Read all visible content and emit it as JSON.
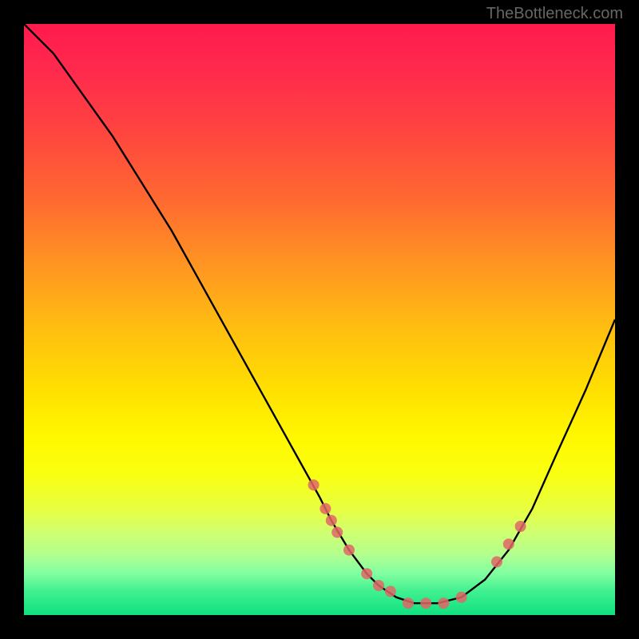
{
  "watermark": "TheBottleneck.com",
  "chart_data": {
    "type": "line",
    "title": "",
    "xlabel": "",
    "ylabel": "",
    "xlim": [
      0,
      100
    ],
    "ylim": [
      0,
      100
    ],
    "curve": {
      "x": [
        0,
        5,
        10,
        15,
        20,
        25,
        30,
        35,
        40,
        45,
        50,
        52,
        55,
        58,
        60,
        63,
        66,
        70,
        74,
        78,
        82,
        86,
        90,
        95,
        100
      ],
      "y": [
        100,
        95,
        88,
        81,
        73,
        65,
        56,
        47,
        38,
        29,
        20,
        16,
        11,
        7,
        5,
        3,
        2,
        2,
        3,
        6,
        11,
        18,
        27,
        38,
        50
      ]
    },
    "markers": {
      "x": [
        49,
        51,
        52,
        53,
        55,
        58,
        60,
        62,
        65,
        68,
        71,
        74,
        80,
        82,
        84
      ],
      "y": [
        22,
        18,
        16,
        14,
        11,
        7,
        5,
        4,
        2,
        2,
        2,
        3,
        9,
        12,
        15
      ]
    },
    "marker_color": "#e06666",
    "curve_color": "#000000"
  }
}
